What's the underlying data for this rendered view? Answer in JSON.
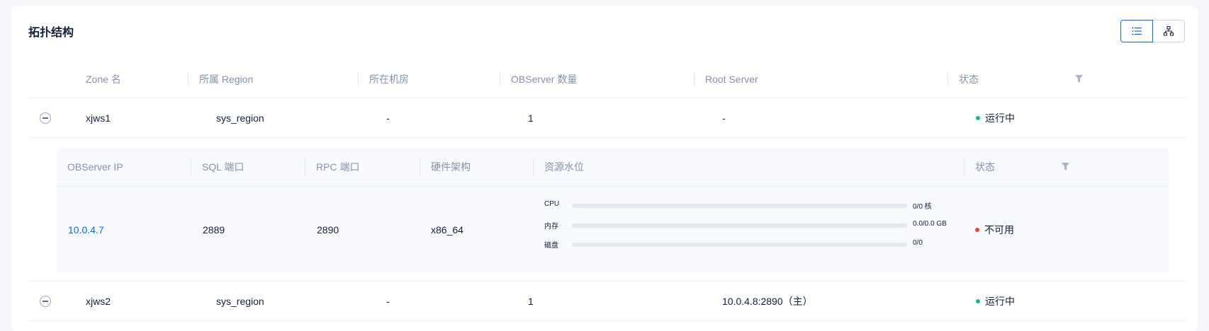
{
  "title": "拓扑结构",
  "view_toggle": {
    "list_icon": "list-icon",
    "tree_icon": "topology-icon"
  },
  "zone_table": {
    "columns": [
      "Zone 名",
      "所属 Region",
      "所在机房",
      "OBServer 数量",
      "Root Server",
      "状态"
    ],
    "rows": [
      {
        "zone": "xjws1",
        "region": "sys_region",
        "idc": "-",
        "count": "1",
        "root_server": "-",
        "status": "运行中"
      },
      {
        "zone": "xjws2",
        "region": "sys_region",
        "idc": "-",
        "count": "1",
        "root_server": "10.0.4.8:2890（主）",
        "status": "运行中"
      }
    ]
  },
  "server_table": {
    "columns": [
      "OBServer IP",
      "SQL 端口",
      "RPC 端口",
      "硬件架构",
      "资源水位",
      "状态"
    ],
    "rows": [
      {
        "ip": "10.0.4.7",
        "sql_port": "2889",
        "rpc_port": "2890",
        "arch": "x86_64",
        "resources": [
          {
            "label": "CPU",
            "value": "0/0 核",
            "ratio": 0
          },
          {
            "label": "内存",
            "value": "0.0/0.0 GB",
            "ratio": 0
          },
          {
            "label": "磁盘",
            "value": "0/0",
            "ratio": 0
          }
        ],
        "status": "不可用"
      }
    ]
  },
  "colors": {
    "running": "#0ac185",
    "unavailable": "#f93939",
    "link": "#006aff"
  }
}
